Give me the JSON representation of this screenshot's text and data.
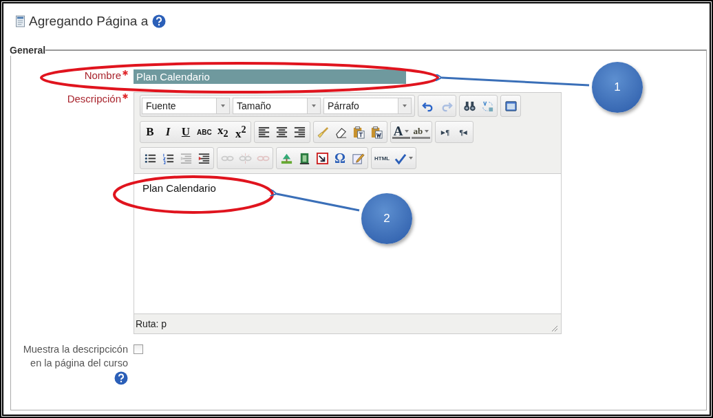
{
  "header": {
    "title": "Agregando Página a"
  },
  "fieldset": {
    "legend": "General"
  },
  "name_field": {
    "label": "Nombre",
    "required": true,
    "value": "Plan Calendario"
  },
  "description": {
    "label": "Descripción",
    "required": true,
    "toolbar": [
      [
        {
          "items": [
            {
              "kind": "select",
              "label": "Fuente"
            },
            {
              "kind": "select",
              "label": "Tamaño"
            },
            {
              "kind": "select",
              "label": "Párrafo"
            }
          ]
        },
        {
          "items": [
            {
              "kind": "undo",
              "disabled": false
            },
            {
              "kind": "redo",
              "disabled": true
            }
          ]
        },
        {
          "items": [
            {
              "kind": "find",
              "disabled": false
            },
            {
              "kind": "replace",
              "disabled": false
            }
          ]
        },
        {
          "items": [
            {
              "kind": "fullscreen",
              "disabled": false
            }
          ]
        }
      ],
      [
        {
          "items": [
            {
              "kind": "bold",
              "label": "B",
              "disabled": false
            },
            {
              "kind": "italic",
              "label": "I",
              "disabled": false
            },
            {
              "kind": "underline",
              "label": "U",
              "disabled": false
            },
            {
              "kind": "strike",
              "label": "ABC",
              "disabled": false
            },
            {
              "kind": "subscript",
              "label": "x$_{2}$",
              "disabled": false
            },
            {
              "kind": "superscript",
              "label": "x$^{2}$",
              "disabled": false
            }
          ]
        },
        {
          "items": [
            {
              "kind": "align-left",
              "disabled": false
            },
            {
              "kind": "align-center",
              "disabled": false
            },
            {
              "kind": "align-right",
              "disabled": false
            }
          ]
        },
        {
          "items": [
            {
              "kind": "brush",
              "disabled": false
            },
            {
              "kind": "eraser",
              "disabled": false
            },
            {
              "kind": "paste-text",
              "disabled": false
            },
            {
              "kind": "paste-word",
              "disabled": false
            }
          ]
        },
        {
          "items": [
            {
              "kind": "font-color",
              "label": "A",
              "disabled": false
            },
            {
              "kind": "highlight",
              "label": "ab",
              "disabled": false
            }
          ]
        },
        {
          "items": [
            {
              "kind": "ltr",
              "label": "▸¶",
              "disabled": false
            },
            {
              "kind": "rtl",
              "label": "¶◂",
              "disabled": false
            }
          ]
        }
      ],
      [
        {
          "items": [
            {
              "kind": "bullets",
              "disabled": false
            },
            {
              "kind": "numbers",
              "disabled": false
            },
            {
              "kind": "outdent",
              "disabled": true
            },
            {
              "kind": "indent",
              "disabled": false
            }
          ]
        },
        {
          "items": [
            {
              "kind": "link",
              "disabled": true
            },
            {
              "kind": "unlink",
              "disabled": true
            },
            {
              "kind": "anchor",
              "disabled": true
            }
          ]
        },
        {
          "items": [
            {
              "kind": "image",
              "disabled": false
            },
            {
              "kind": "media",
              "disabled": false
            },
            {
              "kind": "nolink",
              "disabled": false
            },
            {
              "kind": "omega",
              "label": "Ω",
              "disabled": false
            },
            {
              "kind": "edit",
              "disabled": false
            }
          ]
        },
        {
          "items": [
            {
              "kind": "html",
              "label": "HTML",
              "disabled": false
            },
            {
              "kind": "spell",
              "disabled": false
            }
          ]
        }
      ]
    ],
    "content": "Plan Calendario",
    "path": "Ruta: p"
  },
  "show_description": {
    "label": "Muestra la descripcicón en la página del curso",
    "checked": false
  },
  "annotations": [
    {
      "number": "1"
    },
    {
      "number": "2"
    }
  ]
}
